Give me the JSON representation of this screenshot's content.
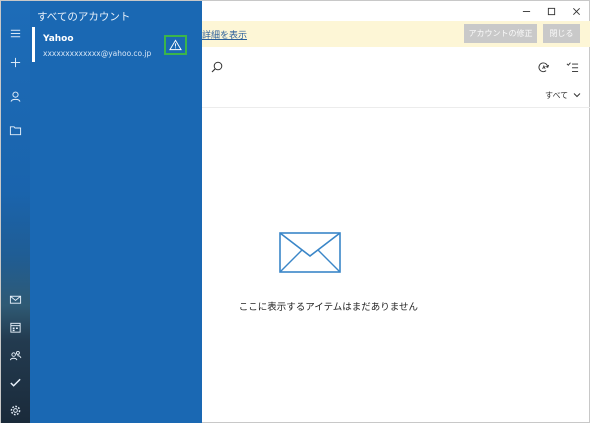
{
  "window": {
    "controls": [
      {
        "name": "minimize-button",
        "icon": "minimize-icon"
      },
      {
        "name": "maximize-button",
        "icon": "maximize-icon"
      },
      {
        "name": "close-button",
        "icon": "close-icon"
      }
    ]
  },
  "rail": {
    "top_items": [
      "hamburger-icon",
      "plus-icon",
      "person-icon",
      "folder-icon"
    ],
    "bottom_items": [
      "mail-icon",
      "calendar-icon",
      "people-icon",
      "todo-icon",
      "settings-icon"
    ]
  },
  "flyout": {
    "title": "すべてのアカウント",
    "account": {
      "name": "Yahoo",
      "email": "xxxxxxxxxxxxx@yahoo.co.jp",
      "status_icon": "warning-icon"
    }
  },
  "infobar": {
    "link_text": "詳細を表示",
    "fix_button": "アカウントの修正",
    "close_button": "閉じる"
  },
  "toolbar": {
    "filter_label": "すべて",
    "icons": [
      "search-icon",
      "sync-icon",
      "selection-mode-icon",
      "chevron-down-icon"
    ]
  },
  "empty_state": {
    "message": "ここに表示するアイテムはまだありません",
    "icon": "envelope-icon"
  },
  "colors": {
    "flyout_bg": "#1a68b3",
    "infobar_bg": "#fdf6d6",
    "highlight": "#3bb54a",
    "envelope": "#3a86c8"
  }
}
